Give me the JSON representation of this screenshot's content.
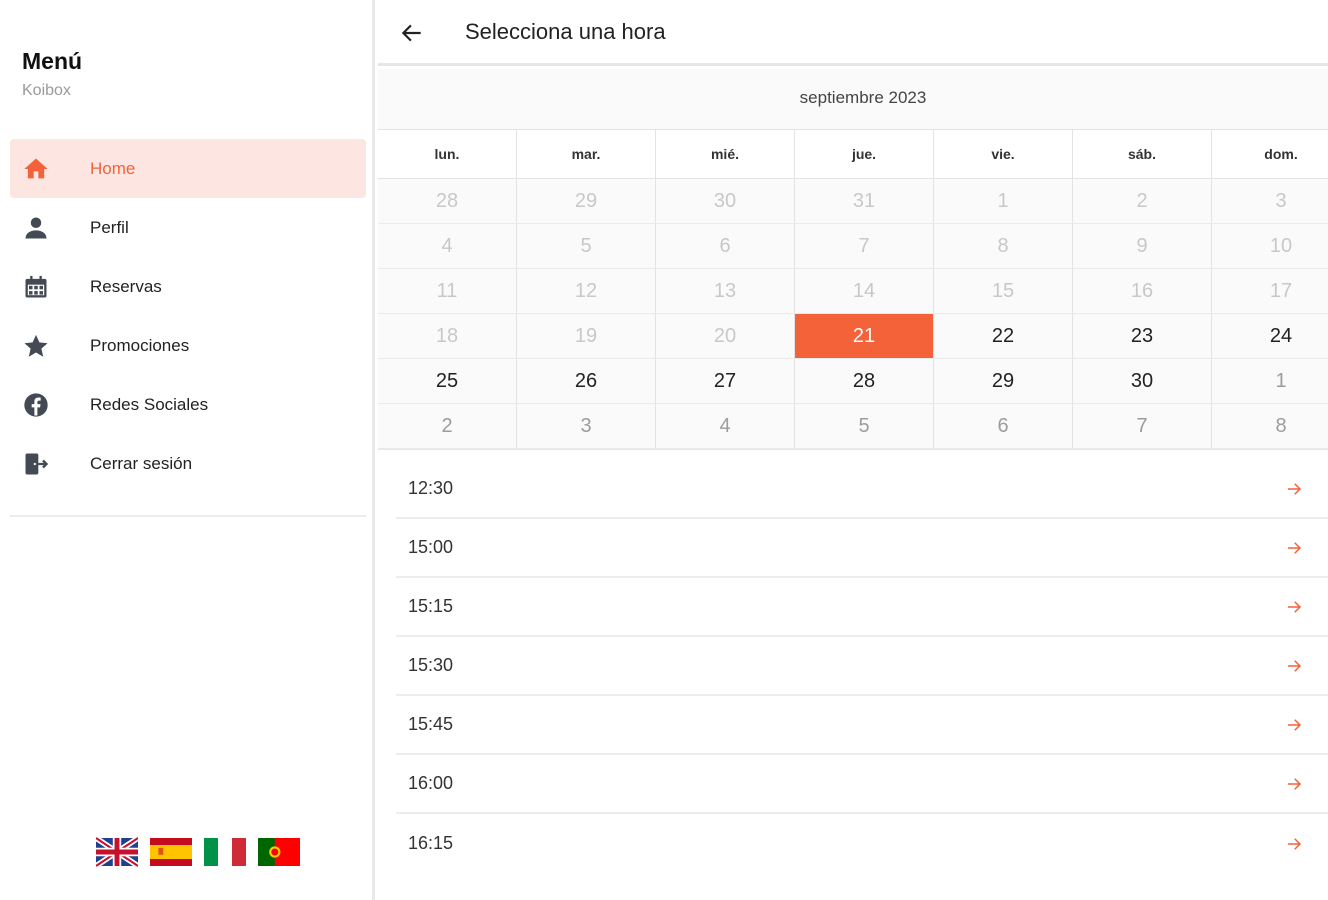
{
  "sidebar": {
    "title": "Menú",
    "subtitle": "Koibox",
    "items": [
      {
        "label": "Home",
        "icon": "home-icon",
        "active": true
      },
      {
        "label": "Perfil",
        "icon": "person-icon",
        "active": false
      },
      {
        "label": "Reservas",
        "icon": "calendar-icon",
        "active": false
      },
      {
        "label": "Promociones",
        "icon": "star-icon",
        "active": false
      },
      {
        "label": "Redes Sociales",
        "icon": "facebook-icon",
        "active": false
      },
      {
        "label": "Cerrar sesión",
        "icon": "logout-icon",
        "active": false
      }
    ],
    "flags": [
      "uk-flag-icon",
      "spain-flag-icon",
      "italy-flag-icon",
      "portugal-flag-icon"
    ]
  },
  "header": {
    "title": "Selecciona una hora",
    "back_icon": "arrow-left-icon"
  },
  "calendar": {
    "month": "septiembre 2023",
    "weekdays": [
      "lun.",
      "mar.",
      "mié.",
      "jue.",
      "vie.",
      "sáb.",
      "dom."
    ],
    "weeks": [
      [
        "28",
        "29",
        "30",
        "31",
        "1",
        "2",
        "3"
      ],
      [
        "4",
        "5",
        "6",
        "7",
        "8",
        "9",
        "10"
      ],
      [
        "11",
        "12",
        "13",
        "14",
        "15",
        "16",
        "17"
      ],
      [
        "18",
        "19",
        "20",
        "21",
        "22",
        "23",
        "24"
      ],
      [
        "25",
        "26",
        "27",
        "28",
        "29",
        "30",
        "1"
      ],
      [
        "2",
        "3",
        "4",
        "5",
        "6",
        "7",
        "8"
      ]
    ],
    "selected_day": "21",
    "colors": {
      "accent": "#f4623a",
      "disabled": "#c8c8c8",
      "other_month": "#9c9c9c"
    }
  },
  "slots": {
    "times": [
      "12:30",
      "15:00",
      "15:15",
      "15:30",
      "15:45",
      "16:00",
      "16:15"
    ],
    "arrow_icon": "arrow-right-icon"
  }
}
